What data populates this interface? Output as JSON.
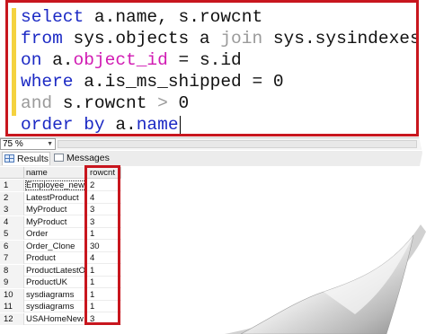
{
  "editor": {
    "lines": [
      {
        "tokens": [
          {
            "t": "select",
            "c": "kw"
          },
          {
            "t": " a.name, s.rowcnt",
            "c": ""
          }
        ]
      },
      {
        "tokens": [
          {
            "t": "from",
            "c": "kw"
          },
          {
            "t": " sys.objects a ",
            "c": ""
          },
          {
            "t": "join",
            "c": "gr"
          },
          {
            "t": " sys.sysindexes s",
            "c": ""
          }
        ]
      },
      {
        "tokens": [
          {
            "t": "on",
            "c": "kw"
          },
          {
            "t": " a.",
            "c": ""
          },
          {
            "t": "object_id",
            "c": "fn"
          },
          {
            "t": " = s.id",
            "c": ""
          }
        ]
      },
      {
        "tokens": [
          {
            "t": "where",
            "c": "kw"
          },
          {
            "t": " a.is_ms_shipped = 0",
            "c": ""
          }
        ]
      },
      {
        "tokens": [
          {
            "t": "and",
            "c": "gr"
          },
          {
            "t": " s.rowcnt ",
            "c": ""
          },
          {
            "t": ">",
            "c": "gr"
          },
          {
            "t": " 0",
            "c": ""
          }
        ]
      },
      {
        "tokens": [
          {
            "t": "order by",
            "c": "kw"
          },
          {
            "t": " a.",
            "c": ""
          },
          {
            "t": "name",
            "c": "kw"
          }
        ]
      }
    ]
  },
  "zoom": {
    "value": "75 %"
  },
  "tabs": {
    "results": "Results",
    "messages": "Messages"
  },
  "grid": {
    "columns": [
      "name",
      "rowcnt"
    ],
    "rows": [
      {
        "n": "1",
        "name": "Employee_new",
        "rowcnt": "2"
      },
      {
        "n": "2",
        "name": "LatestProduct",
        "rowcnt": "4"
      },
      {
        "n": "3",
        "name": "MyProduct",
        "rowcnt": "3"
      },
      {
        "n": "4",
        "name": "MyProduct",
        "rowcnt": "3"
      },
      {
        "n": "5",
        "name": "Order",
        "rowcnt": "1"
      },
      {
        "n": "6",
        "name": "Order_Clone",
        "rowcnt": "30"
      },
      {
        "n": "7",
        "name": "Product",
        "rowcnt": "4"
      },
      {
        "n": "8",
        "name": "ProductLatestOld",
        "rowcnt": "1"
      },
      {
        "n": "9",
        "name": "ProductUK",
        "rowcnt": "1"
      },
      {
        "n": "10",
        "name": "sysdiagrams",
        "rowcnt": "1"
      },
      {
        "n": "11",
        "name": "sysdiagrams",
        "rowcnt": "1"
      },
      {
        "n": "12",
        "name": "USAHomeNew",
        "rowcnt": "3"
      }
    ]
  },
  "colors": {
    "highlight": "#c8161e",
    "keyword": "#1b29c4",
    "function": "#d11bb3",
    "gray": "#9a9a9a"
  }
}
